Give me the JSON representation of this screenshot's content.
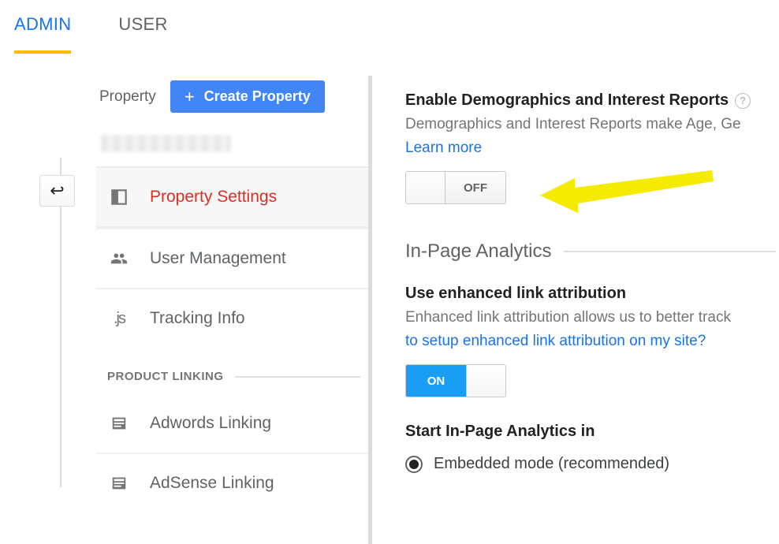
{
  "tabs": {
    "admin": "ADMIN",
    "user": "USER"
  },
  "sidebar": {
    "property_label": "Property",
    "create_button": "Create Property",
    "items": [
      {
        "label": "Property Settings"
      },
      {
        "label": "User Management"
      },
      {
        "label": "Tracking Info"
      }
    ],
    "section_title": "PRODUCT LINKING",
    "linking": [
      {
        "label": "Adwords Linking"
      },
      {
        "label": "AdSense Linking"
      }
    ]
  },
  "content": {
    "demo_heading": "Enable Demographics and Interest Reports",
    "demo_sub": "Demographics and Interest Reports make Age, Ge",
    "learn_more": "Learn more",
    "toggle_off": "OFF",
    "section_inpage": "In-Page Analytics",
    "enhanced_heading": "Use enhanced link attribution",
    "enhanced_sub": "Enhanced link attribution allows us to better track",
    "enhanced_link": "to setup enhanced link attribution on my site?",
    "toggle_on": "ON",
    "start_heading": "Start In-Page Analytics in",
    "radio_embedded": "Embedded mode (recommended)"
  }
}
